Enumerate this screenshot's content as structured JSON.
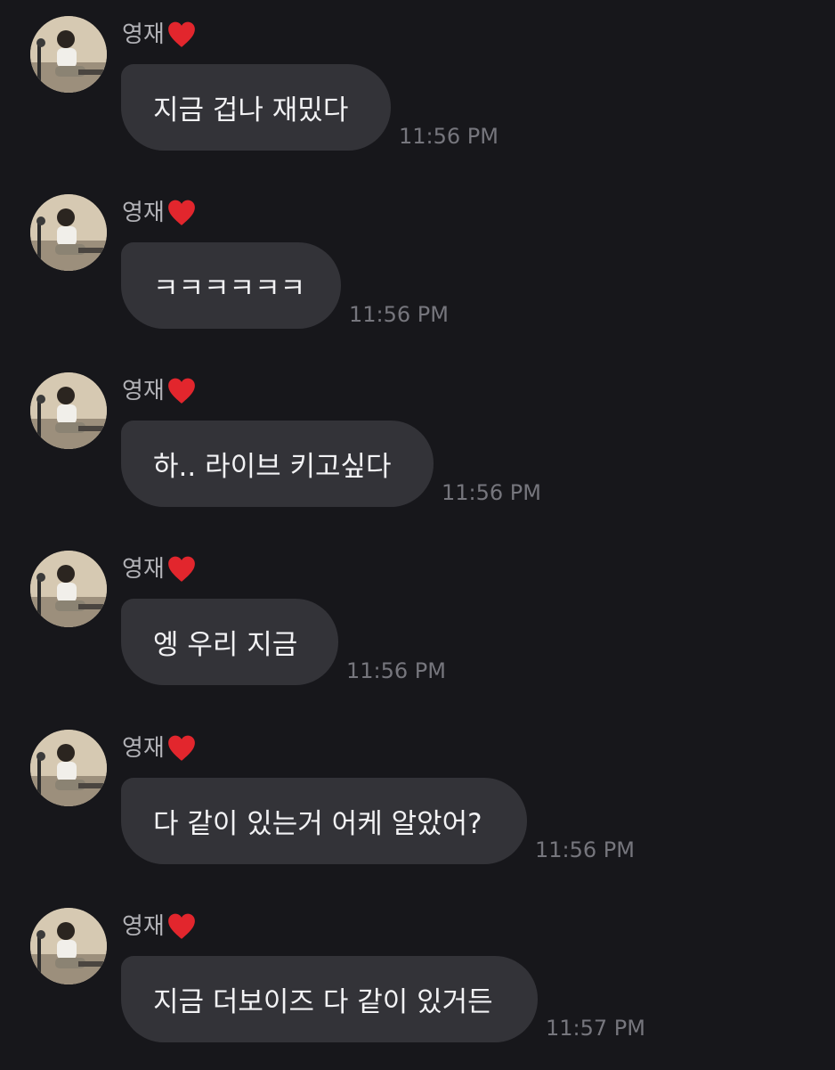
{
  "colors": {
    "background": "#17171b",
    "bubble": "#333338",
    "message_text": "#f2f2f4",
    "sender_name": "#b2b2b7",
    "timestamp": "#76767d",
    "heart": "#e2262d"
  },
  "messages": [
    {
      "sender": "영재",
      "sender_icon": "red-heart-icon",
      "text": "지금 겁나 재밌다",
      "time": "11:56 PM"
    },
    {
      "sender": "영재",
      "sender_icon": "red-heart-icon",
      "text": "ㅋㅋㅋㅋㅋㅋ",
      "time": "11:56 PM"
    },
    {
      "sender": "영재",
      "sender_icon": "red-heart-icon",
      "text": "하.. 라이브 키고싶다",
      "time": "11:56 PM"
    },
    {
      "sender": "영재",
      "sender_icon": "red-heart-icon",
      "text": "엥 우리 지금",
      "time": "11:56 PM"
    },
    {
      "sender": "영재",
      "sender_icon": "red-heart-icon",
      "text": "다 같이 있는거 어케 알았어?",
      "time": "11:56 PM"
    },
    {
      "sender": "영재",
      "sender_icon": "red-heart-icon",
      "text": "지금 더보이즈 다 같이 있거든",
      "time": "11:57 PM"
    }
  ]
}
